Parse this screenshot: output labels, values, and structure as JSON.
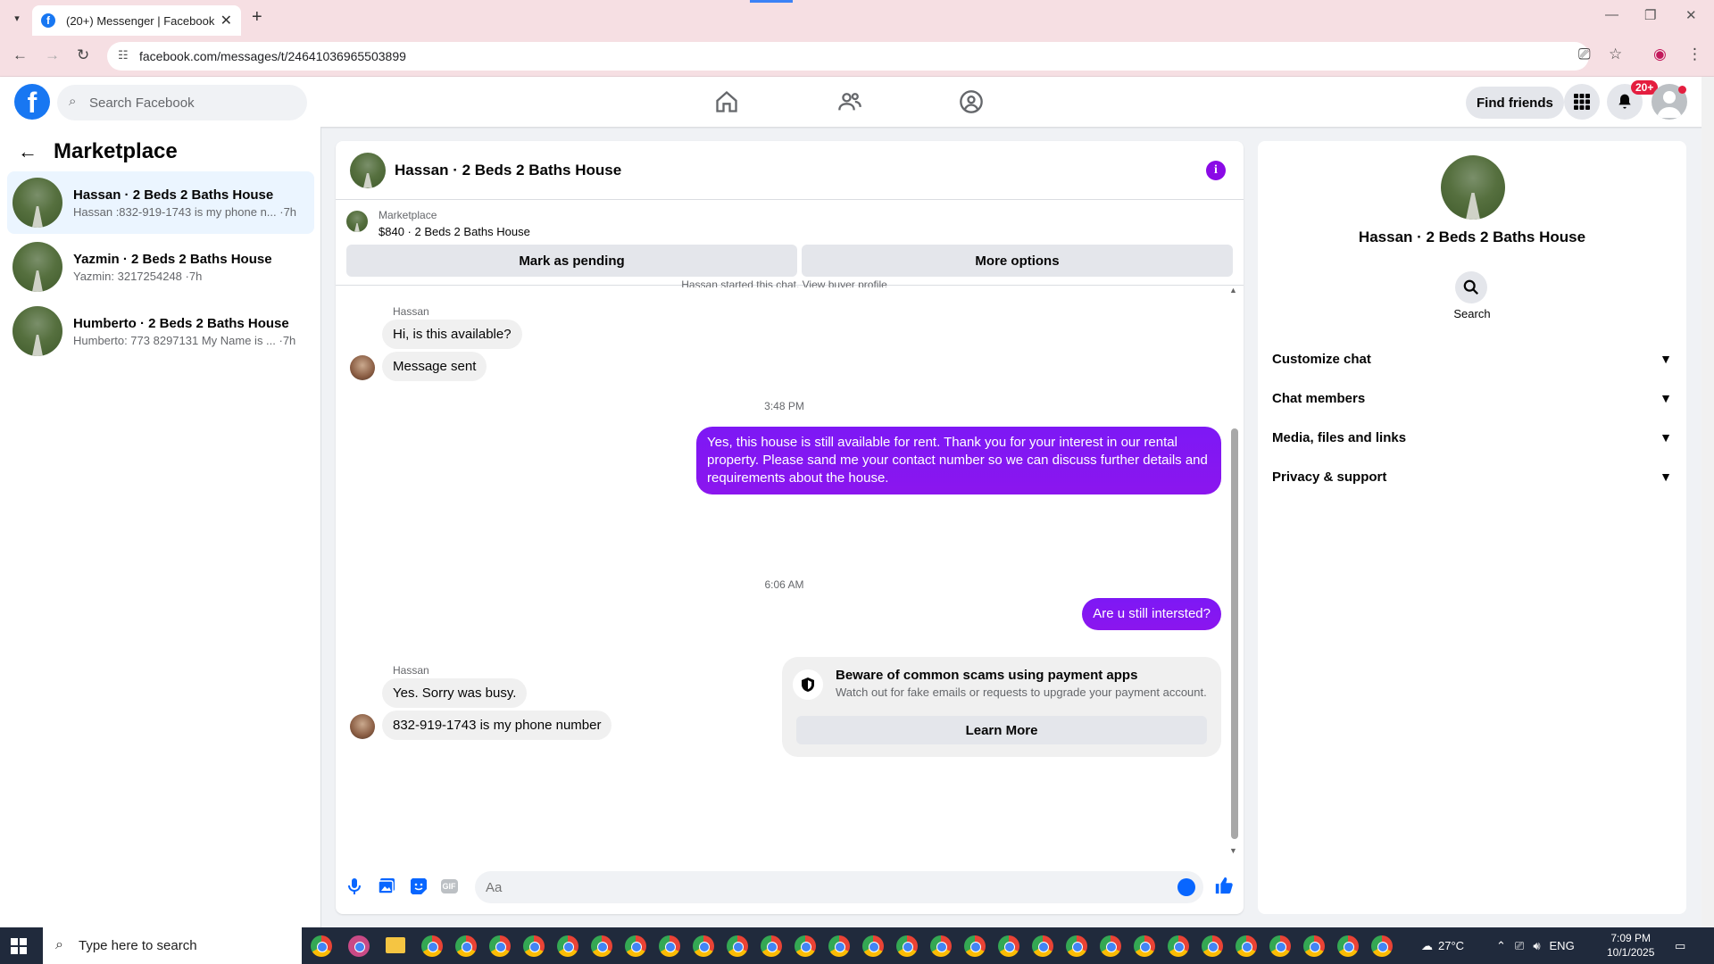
{
  "browser": {
    "tab_title": "(20+) Messenger | Facebook",
    "url": "facebook.com/messages/t/24641036965503899"
  },
  "fbnav": {
    "search_placeholder": "Search Facebook",
    "find_friends": "Find friends",
    "notification_badge": "20+"
  },
  "left": {
    "header": "Marketplace",
    "conversations": [
      {
        "title": "Hassan · 2 Beds 2 Baths House",
        "subtitle": "Hassan :832-919-1743 is my phone n... ·7h",
        "active": true
      },
      {
        "title": "Yazmin · 2 Beds 2 Baths House",
        "subtitle": "Yazmin: 3217254248 ·7h",
        "active": false
      },
      {
        "title": "Humberto · 2 Beds 2 Baths House",
        "subtitle": "Humberto: 773 8297131 My Name is ... ·7h",
        "active": false
      }
    ]
  },
  "chat": {
    "title": "Hassan · 2 Beds 2 Baths House",
    "marketplace_label": "Marketplace",
    "listing": "$840 · 2 Beds 2 Baths House",
    "mark_pending": "Mark as pending",
    "more_options": "More options",
    "partial_top": "Hassan started this chat. View buyer profile",
    "messages": {
      "sender1": "Hassan",
      "m1": "Hi, is this available?",
      "m2": "Message sent",
      "time1": "3:48 PM",
      "out1": "Yes, this house is still available for rent. Thank you for your interest in our rental property. Please sand me your contact number so we can discuss further details and requirements about the house.",
      "scam_title": "Beware of common scams using payment apps",
      "scam_sub": "Watch out for fake emails or requests to upgrade your payment account.",
      "learn_more": "Learn More",
      "time2": "6:06 AM",
      "out2": "Are u still intersted?",
      "sender2": "Hassan",
      "m3": "Yes. Sorry was busy.",
      "m4": "832-919-1743 is my phone number"
    },
    "composer_placeholder": "Aa",
    "accent_color": "#8a16f0"
  },
  "right": {
    "title": "Hassan · 2 Beds 2 Baths House",
    "search_label": "Search",
    "items": [
      "Customize chat",
      "Chat members",
      "Media, files and links",
      "Privacy & support"
    ]
  },
  "taskbar": {
    "search_placeholder": "Type here to search",
    "weather": "27°C",
    "lang": "ENG",
    "time": "7:09 PM",
    "date": "10/1/2025"
  }
}
